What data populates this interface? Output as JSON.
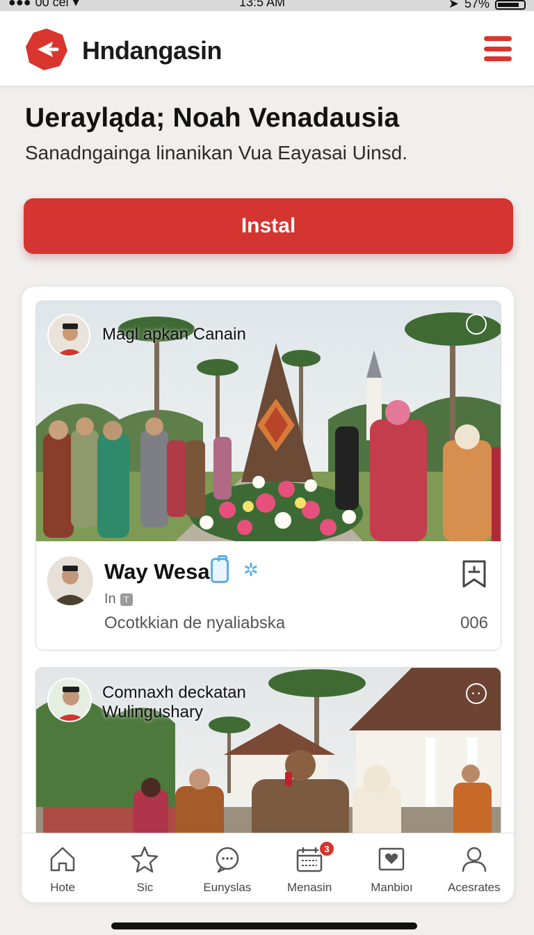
{
  "status_bar": {
    "carrier": "00 cel",
    "time": "13:5 AM",
    "battery": "57%"
  },
  "header": {
    "app_title": "Hndangasin",
    "logo_icon": "brand-logo-icon",
    "menu_icon": "hamburger-menu-icon",
    "accent_color": "#d43530"
  },
  "hero": {
    "title": "Uerayląda; Noah Venadausia",
    "subtitle": "Sanadngainga linanikan Vua Eayasai Uinsd.",
    "install_label": "Instal"
  },
  "posts": [
    {
      "overlay_title": "Magl apkan Canain",
      "author_name": "Way Wesa",
      "author_sub": "In",
      "caption": "Ocotkkian de nyaliabska",
      "count": "006",
      "icons": [
        "verified-badge-icon",
        "gear-icon",
        "bookmark-icon",
        "more-options-icon"
      ]
    },
    {
      "overlay_title": "Comnaxh deckatan Wulingushary",
      "icons": [
        "more-options-icon"
      ]
    }
  ],
  "bottom_nav": {
    "items": [
      {
        "label": "Hote",
        "icon": "home-icon"
      },
      {
        "label": "Sic",
        "icon": "star-icon"
      },
      {
        "label": "Eunyslas",
        "icon": "chat-icon"
      },
      {
        "label": "Menasin",
        "icon": "calendar-icon",
        "badge": "3"
      },
      {
        "label": "Manbioı",
        "icon": "heart-card-icon"
      },
      {
        "label": "Acesrates",
        "icon": "profile-icon"
      }
    ]
  }
}
